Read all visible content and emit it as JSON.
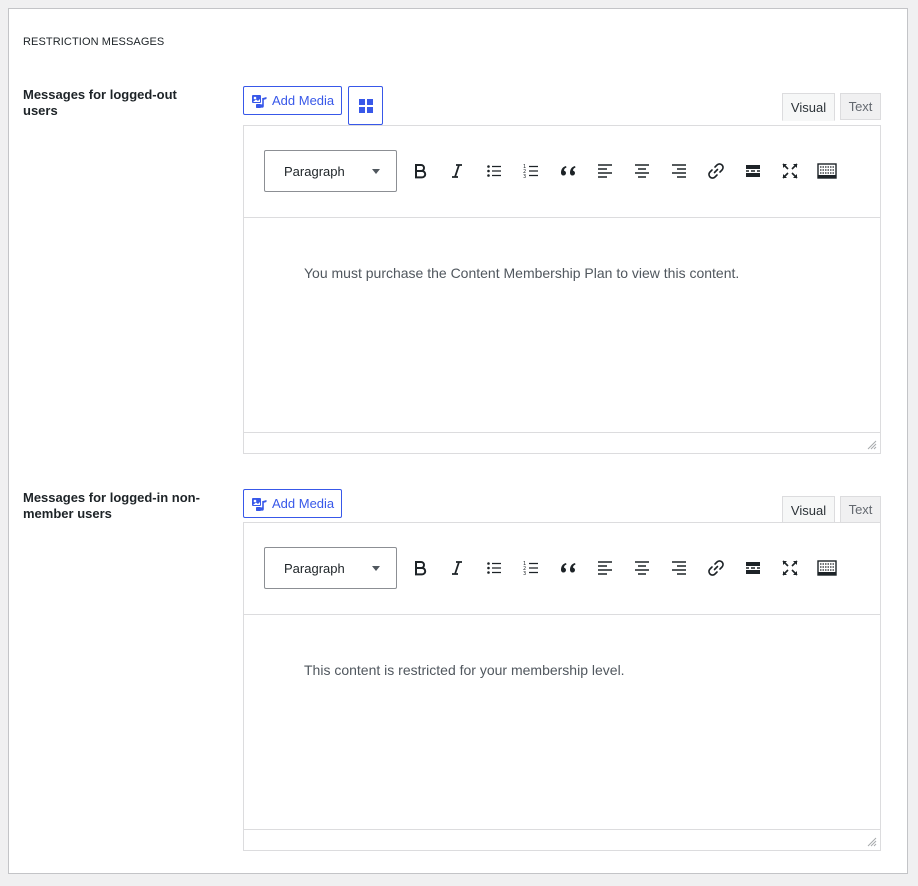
{
  "section_title": "RESTRICTION MESSAGES",
  "common": {
    "add_media_label": "Add Media",
    "visual_tab": "Visual",
    "text_tab": "Text",
    "format_value": "Paragraph"
  },
  "editors": [
    {
      "label": "Messages for logged-out users",
      "content": "You must purchase the Content Membership Plan to view this content."
    },
    {
      "label": "Messages for logged-in non-member users",
      "content": "This content is restricted for your membership level."
    }
  ],
  "toolbar_icons": [
    "bold-icon",
    "italic-icon",
    "bullet-list-icon",
    "numbered-list-icon",
    "blockquote-icon",
    "align-left-icon",
    "align-center-icon",
    "align-right-icon",
    "link-icon",
    "read-more-icon",
    "fullscreen-icon",
    "toolbar-toggle-icon"
  ],
  "colors": {
    "accent": "#3858e9",
    "border": "#dcdcde",
    "text": "#1d2327"
  }
}
